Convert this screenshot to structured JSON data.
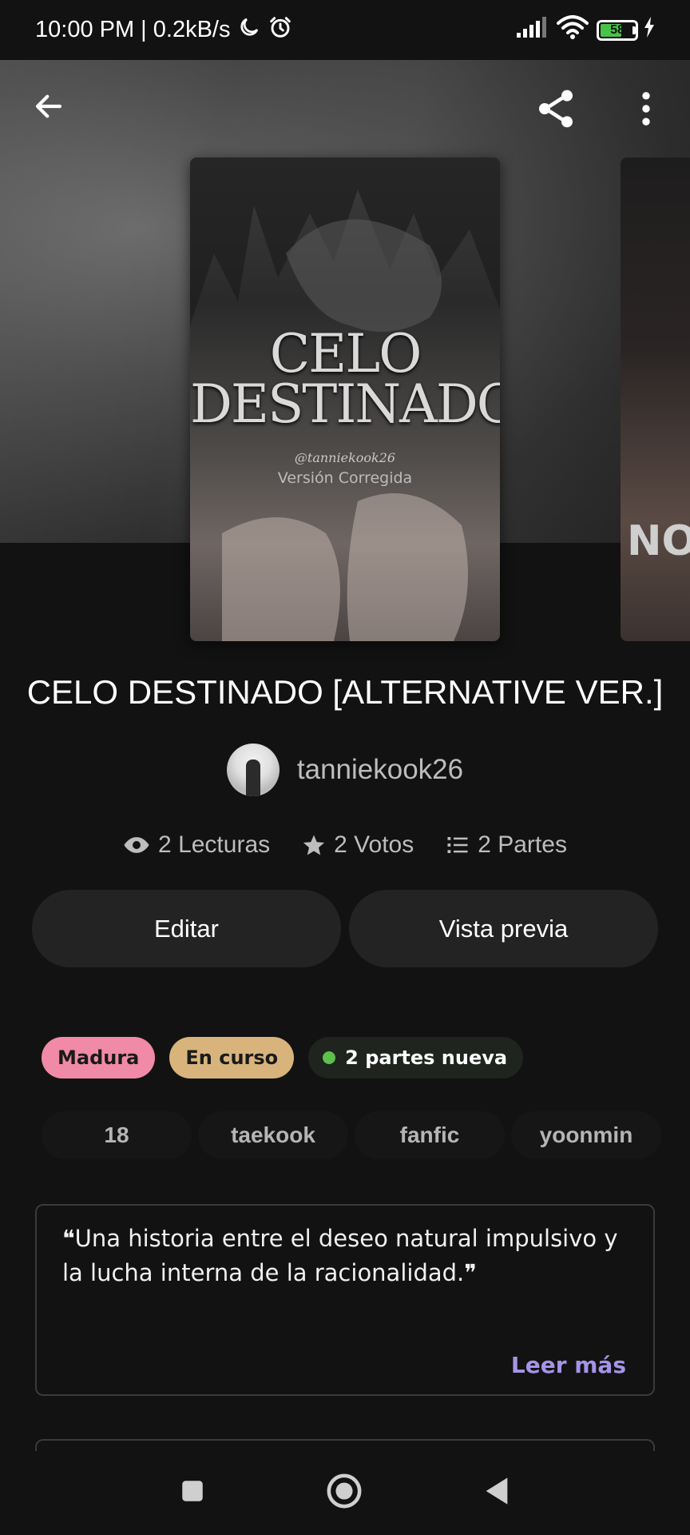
{
  "status_bar": {
    "time_speed": "10:00 PM | 0.2kB/s",
    "battery_level": "58"
  },
  "top_bar": {
    "back_icon": "arrow-left-icon",
    "share_icon": "share-icon",
    "more_icon": "more-vertical-icon"
  },
  "cover": {
    "title_line1": "CELO",
    "title_line2": "DESTINADO",
    "author_tag": "@tanniekook26",
    "subtitle": "Versión Corregida"
  },
  "next_cover": {
    "text": "NO"
  },
  "story": {
    "title": "CELO DESTINADO [ALTERNATIVE VER.]",
    "author": "tanniekook26"
  },
  "stats": {
    "reads": "2 Lecturas",
    "votes": "2 Votos",
    "parts": "2 Partes"
  },
  "actions": {
    "edit_label": "Editar",
    "preview_label": "Vista previa"
  },
  "badges": {
    "mature": "Madura",
    "ongoing": "En curso",
    "new_parts": "2 partes nueva"
  },
  "tags": [
    "18",
    "taekook",
    "fanfic",
    "yoonmin"
  ],
  "description": {
    "text": "❝Una historia entre el deseo natural impulsivo y la lucha interna de la racionalidad.❞",
    "read_more": "Leer más"
  },
  "colors": {
    "background": "#121212",
    "mature_badge": "#f08aa6",
    "ongoing_badge": "#d8b47c",
    "new_dot": "#5cc04a",
    "read_more": "#a594e8"
  }
}
